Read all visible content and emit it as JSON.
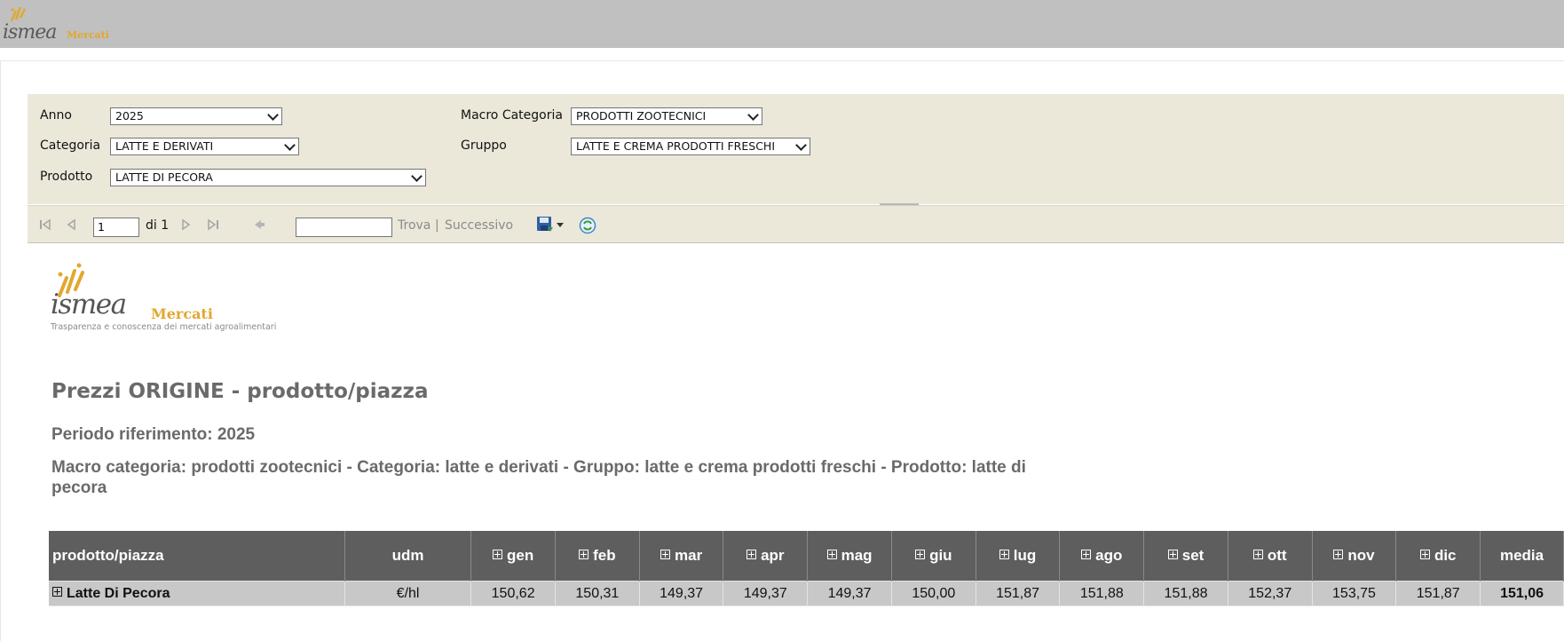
{
  "header": {
    "brand": "ismea",
    "brand_suffix": "Mercati"
  },
  "params": {
    "anno": {
      "label": "Anno",
      "value": "2025"
    },
    "macro_categoria": {
      "label": "Macro Categoria",
      "value": "PRODOTTI ZOOTECNICI"
    },
    "categoria": {
      "label": "Categoria",
      "value": "LATTE E DERIVATI"
    },
    "gruppo": {
      "label": "Gruppo",
      "value": "LATTE E CREMA PRODOTTI FRESCHI"
    },
    "prodotto": {
      "label": "Prodotto",
      "value": "LATTE DI PECORA"
    }
  },
  "toolbar": {
    "page_value": "1",
    "page_of": "di 1",
    "find_label": "Trova",
    "separator": "|",
    "next_label": "Successivo",
    "icons": [
      "first-page-icon",
      "prev-page-icon",
      "next-page-icon",
      "last-page-icon",
      "back-icon",
      "save-icon",
      "dropdown-arrow-icon",
      "refresh-icon"
    ]
  },
  "report": {
    "logo_brand": "ismea",
    "logo_suffix": "Mercati",
    "logo_tagline": "Trasparenza e conoscenza dei mercati agroalimentari",
    "title": "Prezzi ORIGINE - prodotto/piazza",
    "period": "Periodo riferimento: 2025",
    "description": "Macro categoria: prodotti zootecnici - Categoria: latte e derivati - Gruppo: latte e crema prodotti freschi - Prodotto: latte di pecora",
    "table": {
      "columns": [
        "prodotto/piazza",
        "udm",
        "gen",
        "feb",
        "mar",
        "apr",
        "mag",
        "giu",
        "lug",
        "ago",
        "set",
        "ott",
        "nov",
        "dic",
        "media"
      ],
      "rows": [
        {
          "name": "Latte Di Pecora",
          "udm": "€/hl",
          "values": [
            "150,62",
            "150,31",
            "149,37",
            "149,37",
            "149,37",
            "150,00",
            "151,87",
            "151,88",
            "151,88",
            "152,37",
            "153,75",
            "151,87"
          ],
          "media": "151,06"
        }
      ]
    }
  },
  "colors": {
    "header_bg": "#c0c0c0",
    "params_bg": "#ebe8da",
    "table_header_bg": "#5e5e5e",
    "table_row_bg": "#c8c8c8",
    "brand_accent": "#e2a72e",
    "title_text": "#6a6a6a"
  }
}
